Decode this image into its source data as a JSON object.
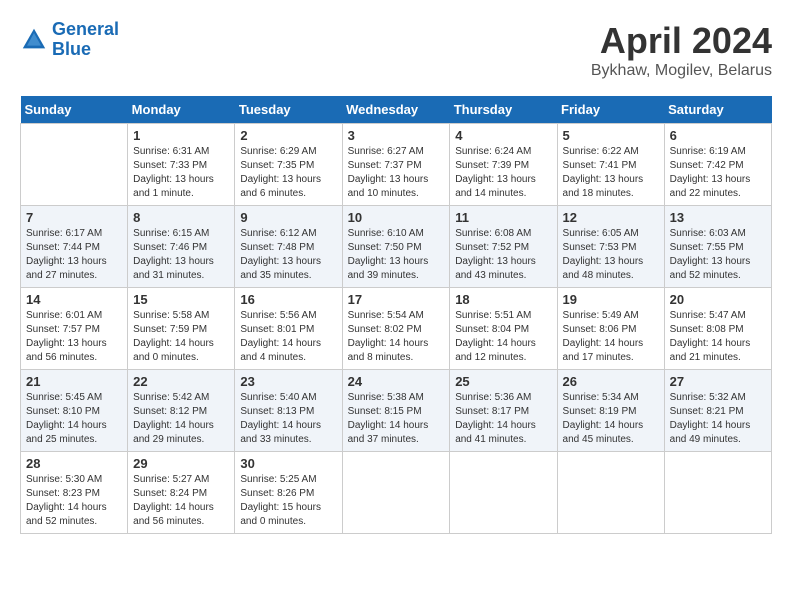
{
  "header": {
    "logo_line1": "General",
    "logo_line2": "Blue",
    "title": "April 2024",
    "subtitle": "Bykhaw, Mogilev, Belarus"
  },
  "columns": [
    "Sunday",
    "Monday",
    "Tuesday",
    "Wednesday",
    "Thursday",
    "Friday",
    "Saturday"
  ],
  "weeks": [
    [
      {
        "day": "",
        "info": ""
      },
      {
        "day": "1",
        "info": "Sunrise: 6:31 AM\nSunset: 7:33 PM\nDaylight: 13 hours\nand 1 minute."
      },
      {
        "day": "2",
        "info": "Sunrise: 6:29 AM\nSunset: 7:35 PM\nDaylight: 13 hours\nand 6 minutes."
      },
      {
        "day": "3",
        "info": "Sunrise: 6:27 AM\nSunset: 7:37 PM\nDaylight: 13 hours\nand 10 minutes."
      },
      {
        "day": "4",
        "info": "Sunrise: 6:24 AM\nSunset: 7:39 PM\nDaylight: 13 hours\nand 14 minutes."
      },
      {
        "day": "5",
        "info": "Sunrise: 6:22 AM\nSunset: 7:41 PM\nDaylight: 13 hours\nand 18 minutes."
      },
      {
        "day": "6",
        "info": "Sunrise: 6:19 AM\nSunset: 7:42 PM\nDaylight: 13 hours\nand 22 minutes."
      }
    ],
    [
      {
        "day": "7",
        "info": "Sunrise: 6:17 AM\nSunset: 7:44 PM\nDaylight: 13 hours\nand 27 minutes."
      },
      {
        "day": "8",
        "info": "Sunrise: 6:15 AM\nSunset: 7:46 PM\nDaylight: 13 hours\nand 31 minutes."
      },
      {
        "day": "9",
        "info": "Sunrise: 6:12 AM\nSunset: 7:48 PM\nDaylight: 13 hours\nand 35 minutes."
      },
      {
        "day": "10",
        "info": "Sunrise: 6:10 AM\nSunset: 7:50 PM\nDaylight: 13 hours\nand 39 minutes."
      },
      {
        "day": "11",
        "info": "Sunrise: 6:08 AM\nSunset: 7:52 PM\nDaylight: 13 hours\nand 43 minutes."
      },
      {
        "day": "12",
        "info": "Sunrise: 6:05 AM\nSunset: 7:53 PM\nDaylight: 13 hours\nand 48 minutes."
      },
      {
        "day": "13",
        "info": "Sunrise: 6:03 AM\nSunset: 7:55 PM\nDaylight: 13 hours\nand 52 minutes."
      }
    ],
    [
      {
        "day": "14",
        "info": "Sunrise: 6:01 AM\nSunset: 7:57 PM\nDaylight: 13 hours\nand 56 minutes."
      },
      {
        "day": "15",
        "info": "Sunrise: 5:58 AM\nSunset: 7:59 PM\nDaylight: 14 hours\nand 0 minutes."
      },
      {
        "day": "16",
        "info": "Sunrise: 5:56 AM\nSunset: 8:01 PM\nDaylight: 14 hours\nand 4 minutes."
      },
      {
        "day": "17",
        "info": "Sunrise: 5:54 AM\nSunset: 8:02 PM\nDaylight: 14 hours\nand 8 minutes."
      },
      {
        "day": "18",
        "info": "Sunrise: 5:51 AM\nSunset: 8:04 PM\nDaylight: 14 hours\nand 12 minutes."
      },
      {
        "day": "19",
        "info": "Sunrise: 5:49 AM\nSunset: 8:06 PM\nDaylight: 14 hours\nand 17 minutes."
      },
      {
        "day": "20",
        "info": "Sunrise: 5:47 AM\nSunset: 8:08 PM\nDaylight: 14 hours\nand 21 minutes."
      }
    ],
    [
      {
        "day": "21",
        "info": "Sunrise: 5:45 AM\nSunset: 8:10 PM\nDaylight: 14 hours\nand 25 minutes."
      },
      {
        "day": "22",
        "info": "Sunrise: 5:42 AM\nSunset: 8:12 PM\nDaylight: 14 hours\nand 29 minutes."
      },
      {
        "day": "23",
        "info": "Sunrise: 5:40 AM\nSunset: 8:13 PM\nDaylight: 14 hours\nand 33 minutes."
      },
      {
        "day": "24",
        "info": "Sunrise: 5:38 AM\nSunset: 8:15 PM\nDaylight: 14 hours\nand 37 minutes."
      },
      {
        "day": "25",
        "info": "Sunrise: 5:36 AM\nSunset: 8:17 PM\nDaylight: 14 hours\nand 41 minutes."
      },
      {
        "day": "26",
        "info": "Sunrise: 5:34 AM\nSunset: 8:19 PM\nDaylight: 14 hours\nand 45 minutes."
      },
      {
        "day": "27",
        "info": "Sunrise: 5:32 AM\nSunset: 8:21 PM\nDaylight: 14 hours\nand 49 minutes."
      }
    ],
    [
      {
        "day": "28",
        "info": "Sunrise: 5:30 AM\nSunset: 8:23 PM\nDaylight: 14 hours\nand 52 minutes."
      },
      {
        "day": "29",
        "info": "Sunrise: 5:27 AM\nSunset: 8:24 PM\nDaylight: 14 hours\nand 56 minutes."
      },
      {
        "day": "30",
        "info": "Sunrise: 5:25 AM\nSunset: 8:26 PM\nDaylight: 15 hours\nand 0 minutes."
      },
      {
        "day": "",
        "info": ""
      },
      {
        "day": "",
        "info": ""
      },
      {
        "day": "",
        "info": ""
      },
      {
        "day": "",
        "info": ""
      }
    ]
  ]
}
